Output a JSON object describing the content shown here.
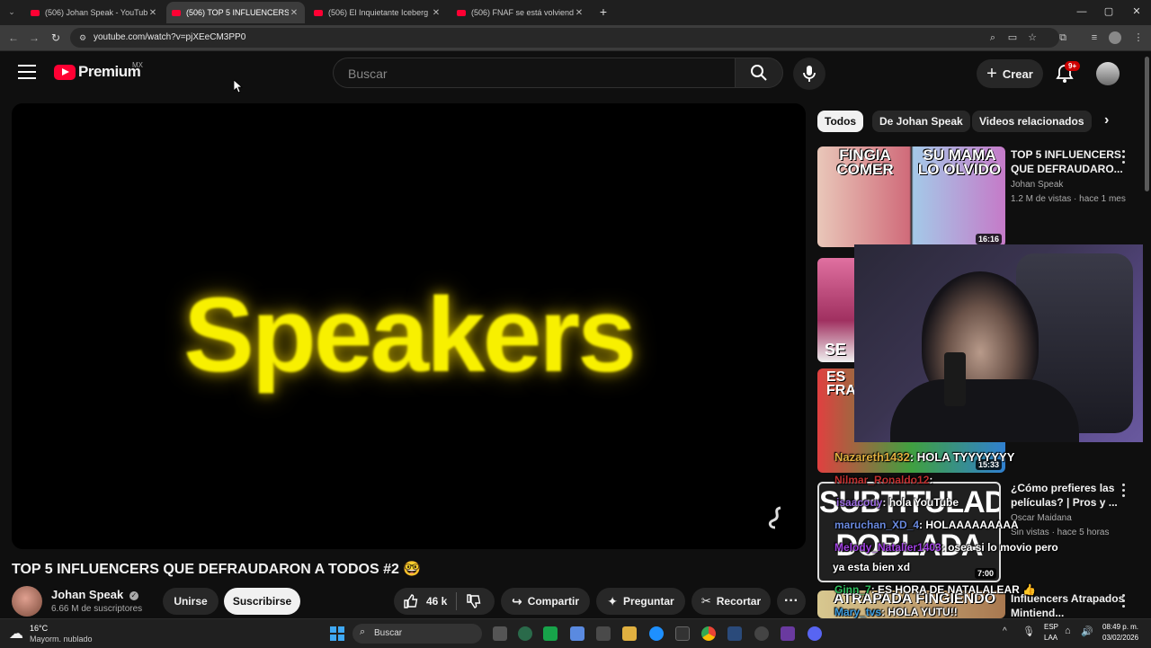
{
  "browser": {
    "tabs": [
      {
        "title": "(506) Johan Speak - YouTube",
        "active": false
      },
      {
        "title": "(506) TOP 5 INFLUENCERS QUE",
        "active": true
      },
      {
        "title": "(506) El Inquietante Iceberg de",
        "active": false
      },
      {
        "title": "(506) FNAF se está volviendo R",
        "active": false
      }
    ],
    "url": "youtube.com/watch?v=pjXEeCM3PP0"
  },
  "header": {
    "brand": "Premium",
    "country": "MX",
    "search_placeholder": "Buscar",
    "create_label": "Crear",
    "notif_badge": "9+"
  },
  "player": {
    "frame_text": "Speakers"
  },
  "video": {
    "title": "TOP 5 INFLUENCERS QUE DEFRAUDARON A TODOS #2 🤓",
    "channel": "Johan Speak",
    "subscribers": "6.66 M de suscriptores",
    "join_label": "Unirse",
    "subscribe_label": "Suscribirse",
    "likes": "46 k",
    "share_label": "Compartir",
    "ask_label": "Preguntar",
    "clip_label": "Recortar"
  },
  "chips": [
    "Todos",
    "De Johan Speak",
    "Videos relacionados"
  ],
  "related": [
    {
      "title": "TOP 5 INFLUENCERS QUE DEFRAUDARO...",
      "channel": "Johan Speak",
      "meta": "1.2 M de vistas · hace 1 mes",
      "duration": "16:16",
      "thumb_text_1": "FINGIA COMER",
      "thumb_text_2": "SU MAMA LO OLVIDO"
    },
    {
      "thumb_text": "SE"
    },
    {
      "thumb_text": "ES FRA",
      "duration": "15:33"
    },
    {
      "title": "¿Cómo prefieres las películas? | Pros y ...",
      "channel": "Oscar Maidana",
      "meta": "Sin vistas · hace 5 horas",
      "duration": "7:00",
      "thumb_text_1": "SUBTITULADA",
      "thumb_text_2": "DOBLADA"
    },
    {
      "title": "Influencers Atrapados Mintiend...",
      "thumb_text": "ATRAPADA FINGIENDO"
    }
  ],
  "chat": [
    {
      "user": "Nazareth1432",
      "msg": ": HOLA TYYYYYYY",
      "color": "#e0b040"
    },
    {
      "user": "Nilmar_Ronaldo12",
      "msg": ":",
      "color": "#c03030"
    },
    {
      "user": "isaacouy",
      "msg": ": hola YouTube",
      "color": "#9a6ae0"
    },
    {
      "user": "maruchan_XD_4",
      "msg": ": HOLAAAAAAAAA",
      "color": "#6a8ae0"
    },
    {
      "user": "Melody_Natalier1403",
      "msg": ": osea si lo movio pero",
      "color": "#a040e0"
    },
    {
      "user": "",
      "msg": "ya esta bien xd",
      "color": "#ffffff"
    },
    {
      "user": "Ginn_7",
      "msg": ": ES HORA DE NATALALEAR 👍",
      "color": "#30c060"
    },
    {
      "user": "Mary_tvs",
      "msg": ": HOLA YUTU!!",
      "color": "#40a0e0"
    }
  ],
  "taskbar": {
    "temp": "16°C",
    "weather": "Mayorm. nublado",
    "search": "Buscar",
    "lang1": "ESP",
    "lang2": "LAA",
    "time": "08:49 p. m.",
    "date": "03/02/2026"
  }
}
